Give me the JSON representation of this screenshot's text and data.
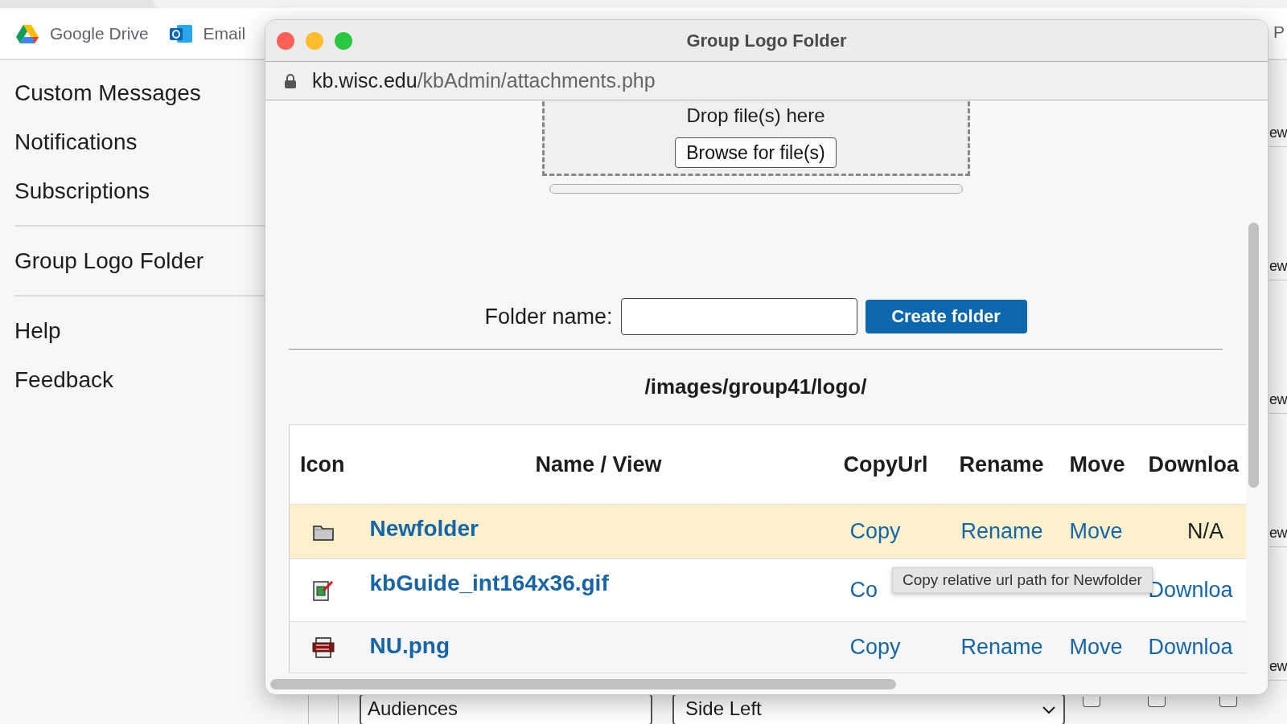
{
  "bookmarks": [
    {
      "kind": "drive",
      "label": "Google Drive"
    },
    {
      "kind": "mail",
      "label": "Email"
    }
  ],
  "edge_text": "P",
  "sidebar": {
    "sections": [
      {
        "items": [
          "Custom Messages",
          "Notifications",
          "Subscriptions"
        ]
      },
      {
        "items": [
          "Group Logo Folder"
        ]
      },
      {
        "items": [
          "Help",
          "Feedback"
        ]
      }
    ]
  },
  "right_edge_texts": [
    "ew",
    "ew",
    "ew",
    "ew",
    "ew"
  ],
  "bottom_form": {
    "audiences": "Audiences",
    "position": "Side Left",
    "checkboxes": [
      {
        "checked": false
      },
      {
        "checked": false
      },
      {
        "checked": false
      }
    ]
  },
  "popup": {
    "title": "Group Logo Folder",
    "url": {
      "host": "kb.wisc.edu",
      "path": "/kbAdmin/attachments.php"
    },
    "drop_zone": {
      "text": "Drop file(s) here",
      "button": "Browse for file(s)",
      "level": 0
    },
    "folder_name": {
      "label": "Folder name:",
      "button": "Create folder"
    },
    "path": "/images/group41/logo/",
    "table": {
      "columns": [
        "Icon",
        "Name / View",
        "CopyUrl",
        "Rename",
        "Move",
        "Downloa"
      ],
      "rows": [
        {
          "kind": "folder",
          "name": "Newfolder",
          "selected": true,
          "copy": "Copy",
          "rename": "Rename",
          "move": "Move",
          "download": "N/A"
        },
        {
          "kind": "gif",
          "name": "kbGuide_int164x36.gif",
          "selected": false,
          "copy": "Co",
          "download": "Downloa"
        },
        {
          "kind": "png",
          "name": "NU.png",
          "selected": false,
          "copy": "Copy",
          "rename": "Rename",
          "move": "Move",
          "download": "Downloa"
        }
      ]
    },
    "tooltip": "Copy relative url path for Newfolder"
  }
}
